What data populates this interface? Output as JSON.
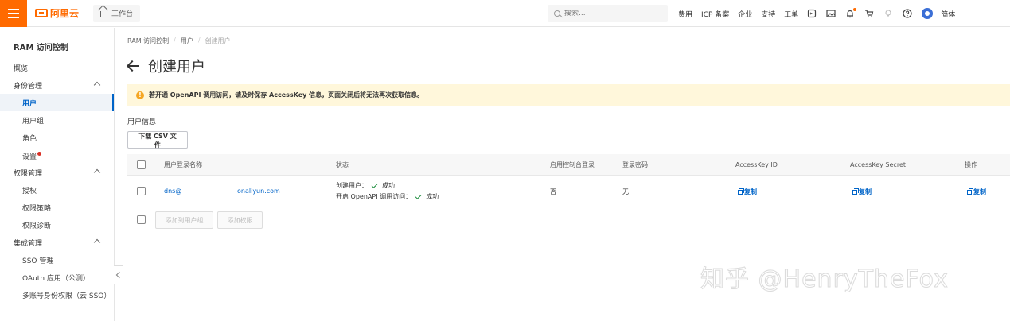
{
  "topbar": {
    "brand": "阿里云",
    "workbench": "工作台",
    "search_placeholder": "搜索...",
    "nav": [
      "费用",
      "ICP 备案",
      "企业",
      "支持",
      "工单"
    ],
    "lang": "简体"
  },
  "sidebar": {
    "title": "RAM 访问控制",
    "items": [
      {
        "label": "概览"
      },
      {
        "label": "身份管理"
      },
      {
        "label": "用户"
      },
      {
        "label": "用户组"
      },
      {
        "label": "角色"
      },
      {
        "label": "设置"
      },
      {
        "label": "权限管理"
      },
      {
        "label": "授权"
      },
      {
        "label": "权限策略"
      },
      {
        "label": "权限诊断"
      },
      {
        "label": "集成管理"
      },
      {
        "label": "SSO 管理"
      },
      {
        "label": "OAuth 应用（公测）"
      },
      {
        "label": "多账号身份权限（云 SSO）"
      }
    ]
  },
  "breadcrumb": [
    "RAM 访问控制",
    "用户",
    "创建用户"
  ],
  "page": {
    "title": "创建用户",
    "alert": "若开通 OpenAPI 调用访问，请及时保存 AccessKey 信息，页面关闭后将无法再次获取信息。",
    "section": "用户信息",
    "download_csv": "下载 CSV 文件"
  },
  "table": {
    "headers": [
      "用户登录名称",
      "状态",
      "启用控制台登录",
      "登录密码",
      "AccessKey ID",
      "AccessKey Secret",
      "操作"
    ],
    "rows": [
      {
        "login_name_prefix": "dns@",
        "login_name_suffix": "onaliyun.com",
        "status_create_label": "创建用户：",
        "status_create_result": "成功",
        "status_api_label": "开启 OpenAPI 调用访问：",
        "status_api_result": "成功",
        "console_login": "否",
        "password": "无",
        "copy_label": "复制"
      }
    ],
    "footer_buttons": [
      "添加到用户组",
      "添加权限"
    ]
  },
  "watermark": "知乎 @HenryTheFox",
  "colors": {
    "accent": "#ff6a00",
    "link": "#0064c8",
    "alert_bg": "#fff7db",
    "success": "#1e8e3e"
  }
}
